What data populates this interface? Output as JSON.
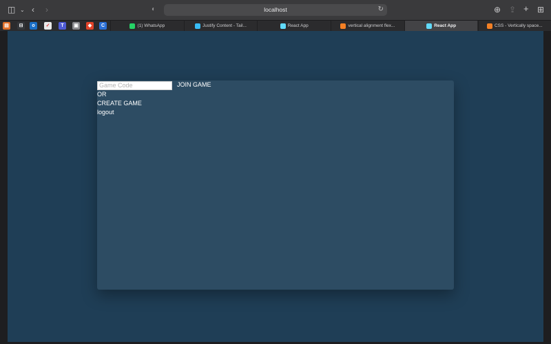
{
  "browser": {
    "url": "localhost",
    "favorites": [
      {
        "icon": "orange-app-icon",
        "color": "#e2702a",
        "glyph": "▤"
      },
      {
        "icon": "screen-app-icon",
        "color": "#34373b",
        "glyph": "⊟"
      },
      {
        "icon": "outlook-icon",
        "color": "#1b6fc7",
        "glyph": "o"
      },
      {
        "icon": "red-checklist-icon",
        "color": "#e9e9e9",
        "glyph": "✓"
      },
      {
        "icon": "teams-icon",
        "color": "#4f5bd5",
        "glyph": "T"
      },
      {
        "icon": "grey-app-icon",
        "color": "#8a8a8e",
        "glyph": "▣"
      },
      {
        "icon": "gitlab-icon",
        "color": "#e24329",
        "glyph": "◆"
      },
      {
        "icon": "blue-c-icon",
        "color": "#2b6fd6",
        "glyph": "C"
      }
    ],
    "tabs": [
      {
        "label": "(1) WhatsApp",
        "icon": "whatsapp-icon",
        "color": "#25d366",
        "active": false
      },
      {
        "label": "Justify Content - Tail...",
        "icon": "tailwind-icon",
        "color": "#38bdf8",
        "active": false
      },
      {
        "label": "React App",
        "icon": "react-icon",
        "color": "#61dafb",
        "active": false
      },
      {
        "label": "vertical alignment flex...",
        "icon": "stackoverflow-icon",
        "color": "#f48024",
        "active": false
      },
      {
        "label": "React App",
        "icon": "react-icon",
        "color": "#61dafb",
        "active": true
      },
      {
        "label": "CSS - Vertically space...",
        "icon": "stackoverflow-icon",
        "color": "#f48024",
        "active": false
      }
    ]
  },
  "page": {
    "game_code_placeholder": "Game Code",
    "game_code_value": "",
    "join_label": "JOIN GAME",
    "or_label": "OR",
    "create_label": "CREATE GAME",
    "logout_label": "logout"
  },
  "colors": {
    "page_background": "#1f3e56",
    "card_background": "#2d4c63",
    "text": "#ffffff"
  }
}
